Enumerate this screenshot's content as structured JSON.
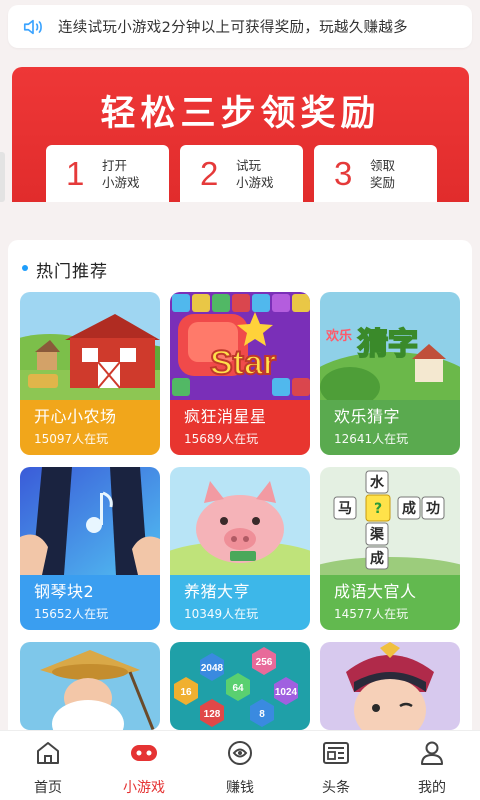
{
  "notice": {
    "text": "连续试玩小游戏2分钟以上可获得奖励，玩越久赚越多",
    "icon": "speaker-icon"
  },
  "banner": {
    "title": "轻松三步领奖励",
    "steps": [
      {
        "num": "1",
        "label": "打开\n小游戏"
      },
      {
        "num": "2",
        "label": "试玩\n小游戏"
      },
      {
        "num": "3",
        "label": "领取\n奖励"
      }
    ]
  },
  "hot": {
    "heading": "热门推荐",
    "games": [
      {
        "name": "开心小农场",
        "players": "15097人在玩",
        "color": "#f1a61b"
      },
      {
        "name": "疯狂消星星",
        "players": "15689人在玩",
        "color": "#e8352f"
      },
      {
        "name": "欢乐猜字",
        "players": "12641人在玩",
        "color": "#5aaa4f"
      },
      {
        "name": "钢琴块2",
        "players": "15652人在玩",
        "color": "#3a9ef0"
      },
      {
        "name": "养猪大亨",
        "players": "10349人在玩",
        "color": "#3db7e9"
      },
      {
        "name": "成语大官人",
        "players": "14577人在玩",
        "color": "#62b94f"
      },
      {
        "name": "",
        "players": ""
      },
      {
        "name": "",
        "players": ""
      },
      {
        "name": "",
        "players": ""
      }
    ],
    "tile_words": {
      "t1": "水",
      "t2": "马",
      "t3": "?",
      "t4": "成",
      "t5": "功",
      "t6": "渠",
      "t7": "成"
    },
    "tile_numbers": [
      "2048",
      "256",
      "16",
      "64",
      "1024",
      "128",
      "8"
    ],
    "art_texts": {
      "star": "Star",
      "guess_small": "欢乐",
      "guess_big": "猜字"
    }
  },
  "tabbar": {
    "items": [
      {
        "label": "首页",
        "icon": "home-icon"
      },
      {
        "label": "小游戏",
        "icon": "gamepad-icon",
        "active": true
      },
      {
        "label": "赚钱",
        "icon": "coin-icon"
      },
      {
        "label": "头条",
        "icon": "news-icon"
      },
      {
        "label": "我的",
        "icon": "profile-icon"
      }
    ]
  },
  "colors": {
    "accent": "#e53333",
    "banner": "#e12c2c",
    "dot": "#1e9dfb"
  }
}
